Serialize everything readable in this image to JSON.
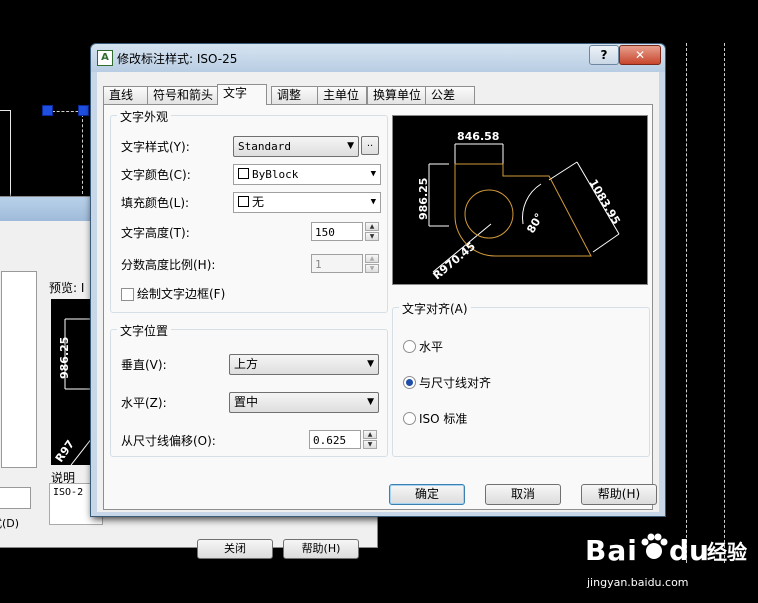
{
  "dialog": {
    "title": "修改标注样式: ISO-25",
    "help_glyph": "?",
    "close_glyph": "✕"
  },
  "tabs": [
    {
      "label": "直线",
      "active": false
    },
    {
      "label": "符号和箭头",
      "active": false
    },
    {
      "label": "文字",
      "active": true
    },
    {
      "label": "调整",
      "active": false
    },
    {
      "label": "主单位",
      "active": false
    },
    {
      "label": "换算单位",
      "active": false
    },
    {
      "label": "公差",
      "active": false
    }
  ],
  "appearance": {
    "title": "文字外观",
    "text_style_label": "文字样式(Y):",
    "text_style_value": "Standard",
    "ellipsis": "..",
    "text_color_label": "文字颜色(C):",
    "text_color_value": "ByBlock",
    "fill_color_label": "填充颜色(L):",
    "fill_color_value": "无",
    "text_height_label": "文字高度(T):",
    "text_height_value": "150",
    "fraction_scale_label": "分数高度比例(H):",
    "fraction_scale_value": "1",
    "frame_label": "绘制文字边框(F)",
    "frame_checked": false
  },
  "placement": {
    "title": "文字位置",
    "vertical_label": "垂直(V):",
    "vertical_value": "上方",
    "horizontal_label": "水平(Z):",
    "horizontal_value": "置中",
    "offset_label": "从尺寸线偏移(O):",
    "offset_value": "0.625"
  },
  "alignment": {
    "title": "文字对齐(A)",
    "options": [
      {
        "label": "水平",
        "selected": false
      },
      {
        "label": "与尺寸线对齐",
        "selected": true
      },
      {
        "label": "ISO 标准",
        "selected": false
      }
    ]
  },
  "preview": {
    "dim_top": "846.58",
    "dim_left": "986.25",
    "dim_right": "1083.95",
    "dim_angle": "80°",
    "dim_radius": "R970.45"
  },
  "buttons": {
    "ok": "确定",
    "cancel": "取消",
    "help": "帮助(H)"
  },
  "background_dialog": {
    "preview_label": "预览: I",
    "preview_dim": "986.25",
    "preview_radius": "R97",
    "desc_label": "说明",
    "desc_text": "ISO-2",
    "left_label": "式(D)",
    "close_btn": "关闭",
    "help_btn": "帮助(H)"
  },
  "watermark": {
    "brand": "Bai",
    "brand2": "du",
    "cn": "经验",
    "url": "jingyan.baidu.com"
  },
  "colors": {
    "preview_lines": "#d39a3a",
    "preview_text": "#ffffff",
    "radio_dot": "#1f4ea8"
  }
}
